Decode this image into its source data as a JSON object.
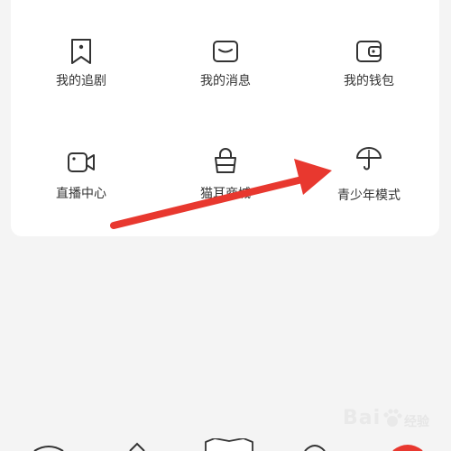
{
  "menu": {
    "items": [
      {
        "label": "我的追剧",
        "icon": "bookmark-icon"
      },
      {
        "label": "我的消息",
        "icon": "message-icon"
      },
      {
        "label": "我的钱包",
        "icon": "wallet-icon"
      },
      {
        "label": "直播中心",
        "icon": "video-camera-icon"
      },
      {
        "label": "猫耳商城",
        "icon": "shopping-bag-icon"
      },
      {
        "label": "青少年模式",
        "icon": "umbrella-icon"
      }
    ]
  },
  "watermark": {
    "brand": "Bai",
    "sub": "经验"
  },
  "colors": {
    "arrow": "#e8382f",
    "background": "#f4f4f4",
    "card": "#ffffff"
  }
}
